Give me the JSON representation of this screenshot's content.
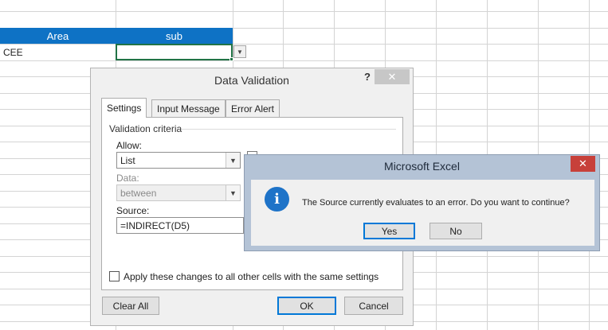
{
  "sheet": {
    "headers": [
      "Area",
      "sub"
    ],
    "cells": {
      "a2": "CEE"
    }
  },
  "data_validation": {
    "title": "Data Validation",
    "help": "?",
    "close": "✕",
    "tabs": [
      "Settings",
      "Input Message",
      "Error Alert"
    ],
    "group_label": "Validation criteria",
    "allow_label": "Allow:",
    "allow_value": "List",
    "data_label": "Data:",
    "data_value": "between",
    "source_label": "Source:",
    "source_value": "=INDIRECT(D5)",
    "apply_label": "Apply these changes to all other cells with the same settings",
    "buttons": {
      "clear_all": "Clear All",
      "ok": "OK",
      "cancel": "Cancel"
    }
  },
  "alert": {
    "title": "Microsoft Excel",
    "close": "✕",
    "icon": "i",
    "message": "The Source currently evaluates to an error. Do you want to continue?",
    "buttons": {
      "yes": "Yes",
      "no": "No"
    }
  },
  "colors": {
    "header_blue": "#0e72c5",
    "selection_green": "#217346",
    "alert_frame": "#b4c3d6",
    "alert_close_red": "#c7403a",
    "info_icon_blue": "#1e73c8"
  }
}
